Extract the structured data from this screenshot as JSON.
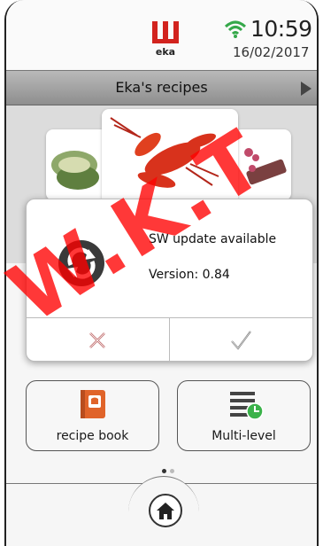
{
  "status": {
    "brand": "eka",
    "time": "10:59",
    "date": "16/02/2017"
  },
  "header": {
    "title": "Eka's recipes"
  },
  "dialog": {
    "message": "SW update available",
    "version": "Version: 0.84"
  },
  "tiles": {
    "recipe_book": "recipe book",
    "multi_level": "Multi-level"
  },
  "pager": {
    "pages": 2,
    "active": 1
  },
  "watermark": "W.K.T",
  "colors": {
    "brand_red": "#d2231e",
    "timer_green": "#3bb24a",
    "wifi_green": "#35a84a",
    "book_orange": "#e0642a"
  }
}
